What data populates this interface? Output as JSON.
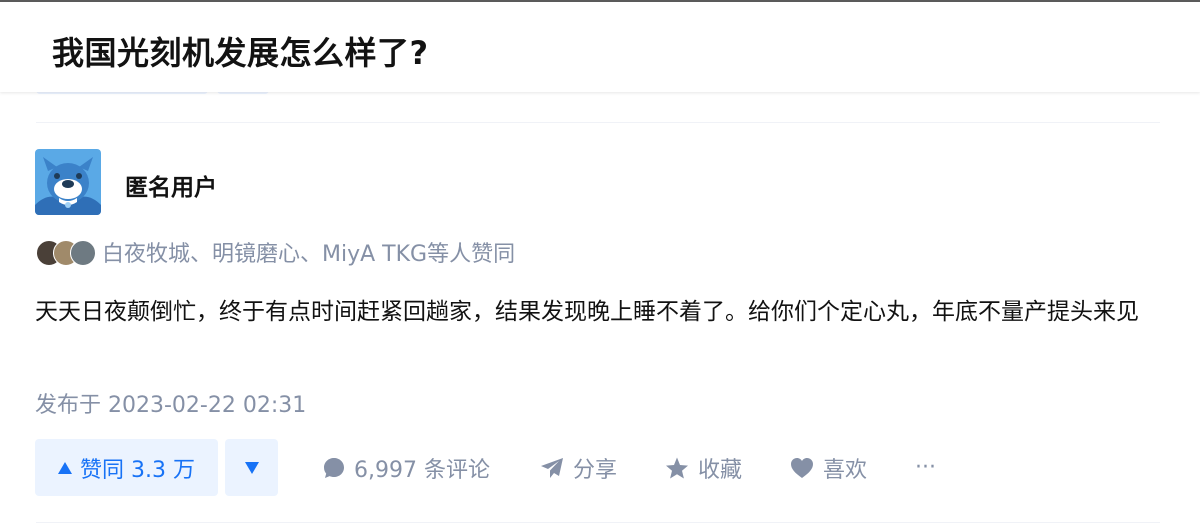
{
  "question": {
    "title": "我国光刻机发展怎么样了?"
  },
  "answer": {
    "author": {
      "name": "匿名用户",
      "avatar_icon": "anonymous-user-icon"
    },
    "voters_text": "白夜牧城、明镜磨心、MiyA TKG等人赞同",
    "content": "天天日夜颠倒忙，终于有点时间赶紧回趟家，结果发现晚上睡不着了。给你们个定心丸，年底不量产提头来见",
    "publish_time": "发布于 2023-02-22 02:31"
  },
  "actions": {
    "upvote_label": "赞同 3.3 万",
    "comments_label": "6,997 条评论",
    "share_label": "分享",
    "favorite_label": "收藏",
    "like_label": "喜欢",
    "more_label": "···"
  },
  "colors": {
    "accent": "#1772f6",
    "accent_bg": "#ebf3ff",
    "muted": "#8590a6",
    "text": "#121212"
  }
}
